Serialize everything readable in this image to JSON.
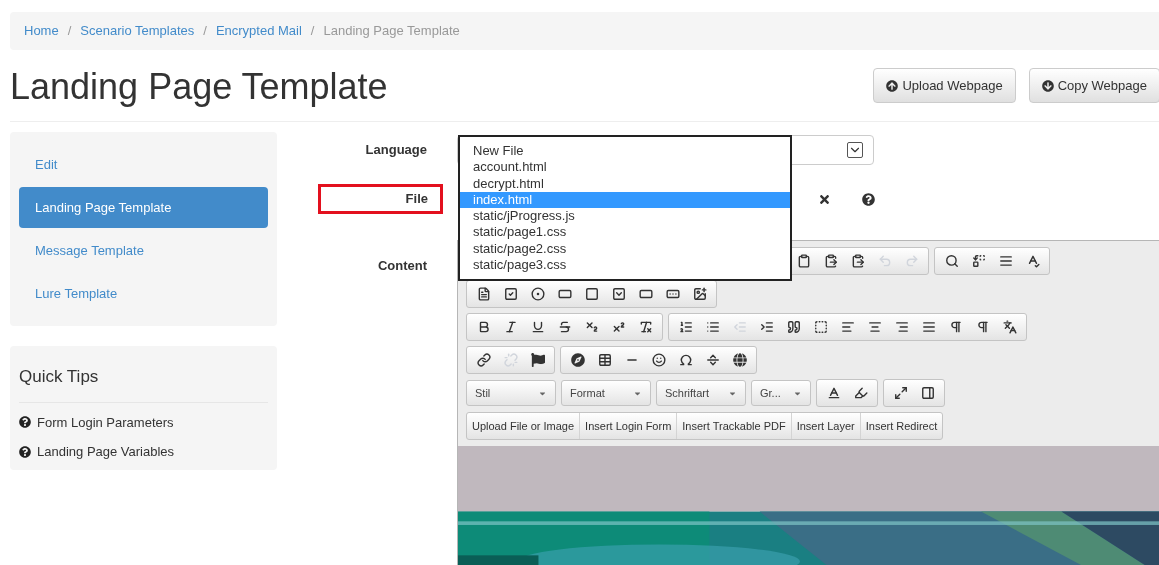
{
  "breadcrumb": {
    "separator": "/",
    "items": [
      {
        "label": "Home",
        "kind": "link"
      },
      {
        "label": "Scenario Templates",
        "kind": "link"
      },
      {
        "label": "Encrypted Mail",
        "kind": "link"
      },
      {
        "label": "Landing Page Template",
        "kind": "current"
      }
    ]
  },
  "title": "Landing Page Template",
  "header_buttons": [
    {
      "label": "Upload Webpage",
      "kind": "upload"
    },
    {
      "label": "Copy Webpage",
      "kind": "copy"
    }
  ],
  "sidebar": {
    "items": [
      {
        "label": "Edit",
        "selected": false
      },
      {
        "label": "Landing Page Template",
        "selected": true
      },
      {
        "label": "Message Template",
        "selected": false
      },
      {
        "label": "Lure Template",
        "selected": false
      }
    ]
  },
  "quick_tips": {
    "title": "Quick Tips",
    "items": [
      "Form Login Parameters",
      "Landing Page Variables"
    ]
  },
  "form": {
    "language_label": "Language",
    "file_label": "File",
    "file_highlighted": true,
    "content_label": "Content",
    "file_options": [
      {
        "label": "New File",
        "selected": false
      },
      {
        "label": "account.html",
        "selected": false
      },
      {
        "label": "decrypt.html",
        "selected": false
      },
      {
        "label": "index.html",
        "selected": true
      },
      {
        "label": "static/jProgress.js",
        "selected": false
      },
      {
        "label": "static/page1.css",
        "selected": false
      },
      {
        "label": "static/page2.css",
        "selected": false
      },
      {
        "label": "static/page3.css",
        "selected": false
      }
    ]
  },
  "editor": {
    "combos": [
      "Stil",
      "Format",
      "Schriftart",
      "Gr..."
    ],
    "custom_buttons": [
      "Upload File or Image",
      "Insert Login Form",
      "Insert Trackable PDF",
      "Insert Layer",
      "Insert Redirect"
    ],
    "content": {
      "kind": "picture"
    }
  }
}
